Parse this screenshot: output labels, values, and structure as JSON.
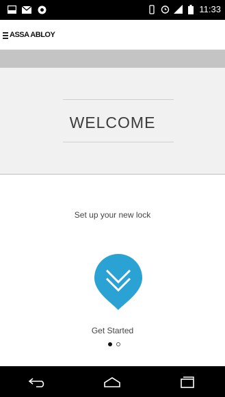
{
  "status_bar": {
    "time": "11:33",
    "left_icons": [
      "screenshot-icon",
      "mail-icon",
      "chrome-icon"
    ],
    "right_icons": [
      "vibrate-icon",
      "alarm-icon",
      "signal-icon",
      "battery-icon"
    ]
  },
  "app_bar": {
    "brand": "ASSA ABLOY",
    "menu_icon": "hamburger-icon"
  },
  "welcome": {
    "title": "WELCOME"
  },
  "content": {
    "subtitle": "Set up your new lock",
    "start_icon": "double-chevron-down-icon",
    "start_label": "Get Started",
    "accent_color": "#2aa3d4",
    "page_count": 2,
    "active_page": 1
  },
  "nav_bar": {
    "buttons": [
      "back-icon",
      "home-icon",
      "recents-icon"
    ]
  }
}
